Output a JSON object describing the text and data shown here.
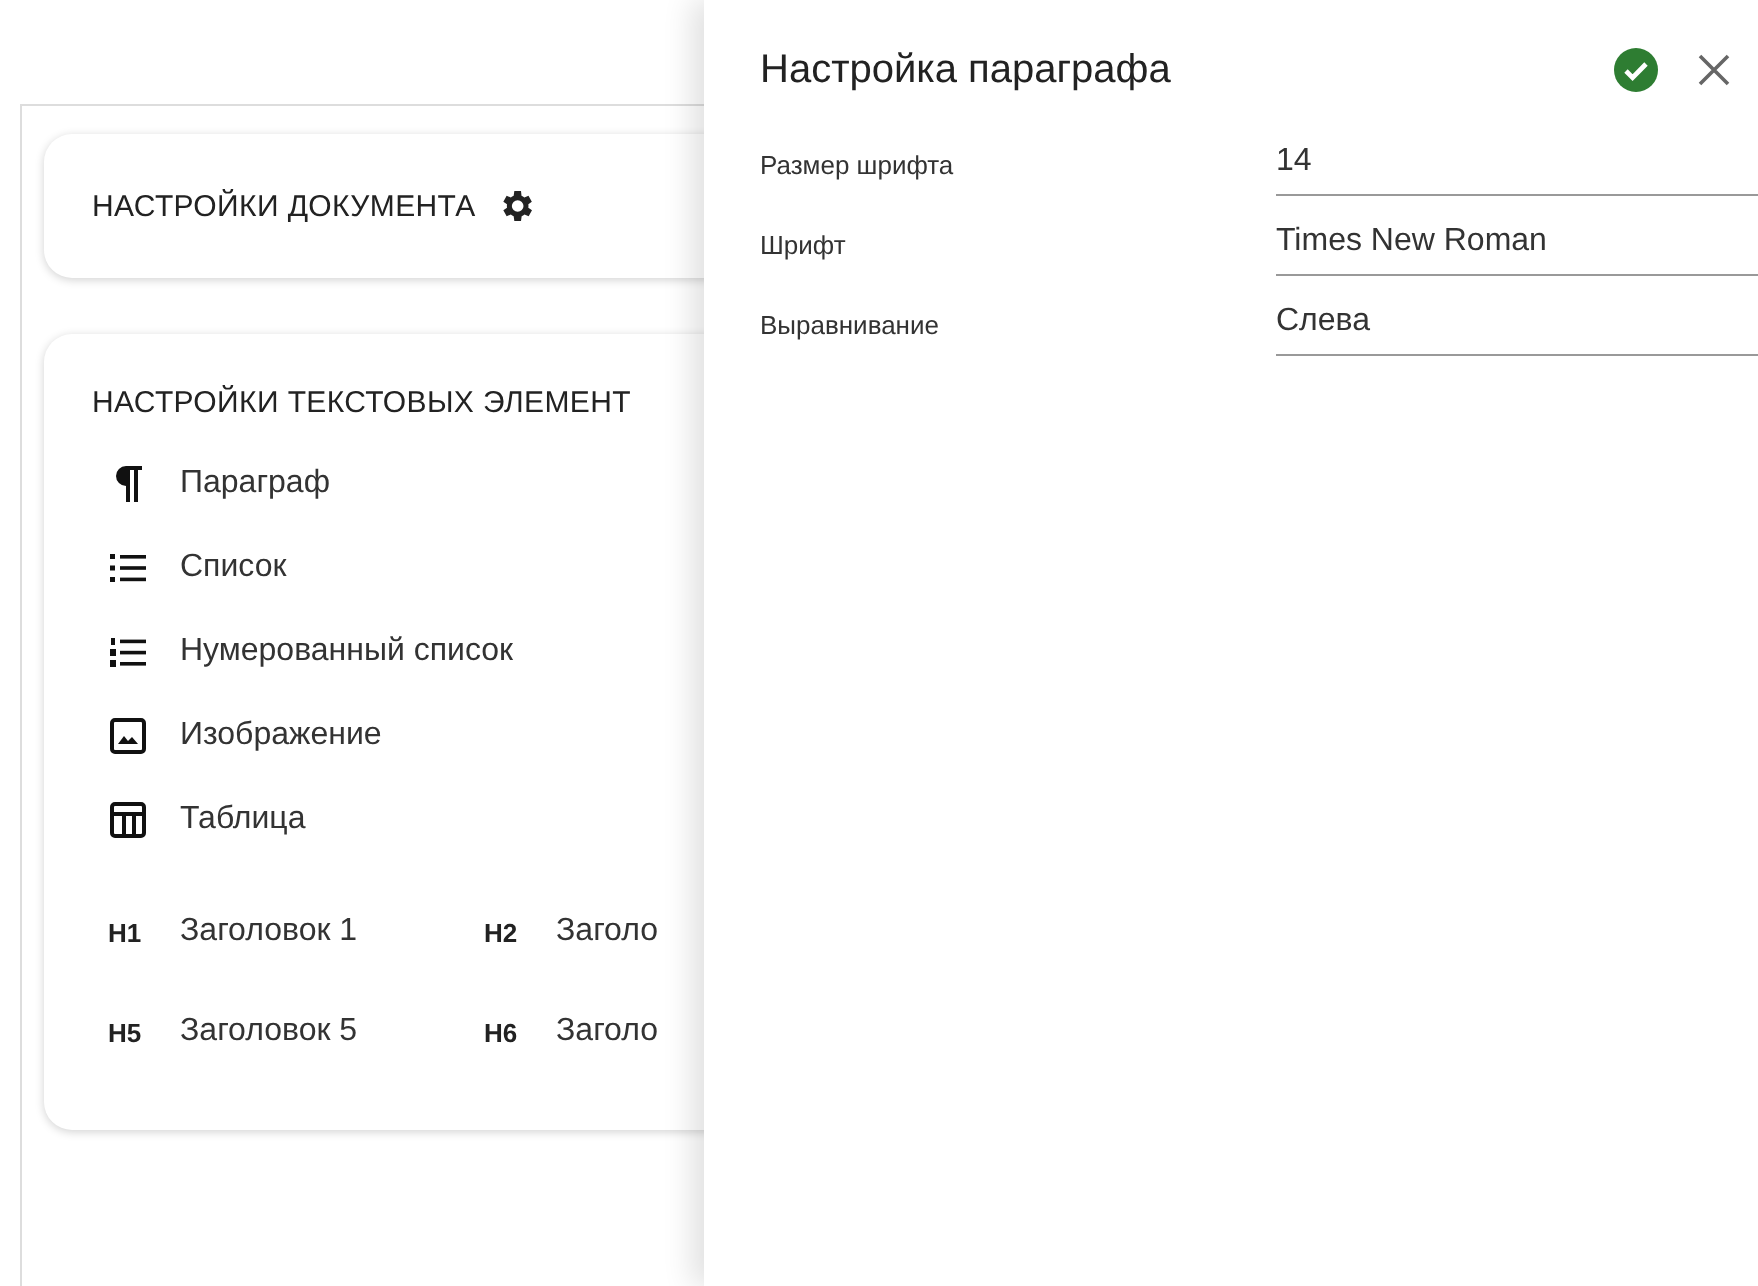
{
  "document_card": {
    "title": "НАСТРОЙКИ ДОКУМЕНТА"
  },
  "elements_card": {
    "title": "НАСТРОЙКИ ТЕКСТОВЫХ ЭЛЕМЕНТ",
    "items": [
      {
        "kind": "paragraph",
        "label": "Параграф"
      },
      {
        "kind": "list",
        "label": "Список"
      },
      {
        "kind": "numbered",
        "label": "Нумерованный список"
      },
      {
        "kind": "image",
        "label": "Изображение"
      },
      {
        "kind": "table",
        "label": "Таблица"
      }
    ],
    "headings": [
      {
        "badge": "H1",
        "label": "Заголовок 1"
      },
      {
        "badge": "H2",
        "label": "Заголо"
      },
      {
        "badge": "H5",
        "label": "Заголовок 5"
      },
      {
        "badge": "H6",
        "label": "Заголо"
      }
    ]
  },
  "drawer": {
    "title": "Настройка параграфа",
    "fields": [
      {
        "label": "Размер шрифта",
        "value": "14"
      },
      {
        "label": "Шрифт",
        "value": "Times New Roman"
      },
      {
        "label": "Выравнивание",
        "value": "Слева"
      }
    ]
  }
}
